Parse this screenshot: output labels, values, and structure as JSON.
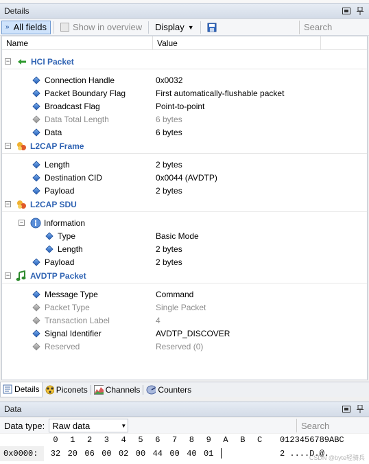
{
  "details_panel": {
    "title": "Details"
  },
  "toolbar": {
    "all_fields": "All fields",
    "show_in_overview": "Show in overview",
    "display": "Display",
    "search_placeholder": "Search"
  },
  "columns": {
    "name": "Name",
    "value": "Value"
  },
  "groups": [
    {
      "title": "HCI Packet",
      "icon": "green-arrow-left-icon",
      "fields": [
        {
          "name": "Connection Handle",
          "value": "0x0032",
          "greyed": false
        },
        {
          "name": "Packet Boundary Flag",
          "value": "First automatically-flushable packet",
          "greyed": false
        },
        {
          "name": "Broadcast Flag",
          "value": "Point-to-point",
          "greyed": false
        },
        {
          "name": "Data Total Length",
          "value": "6 bytes",
          "greyed": true
        },
        {
          "name": "Data",
          "value": "6 bytes",
          "greyed": false
        }
      ]
    },
    {
      "title": "L2CAP Frame",
      "icon": "l2cap-frame-icon",
      "fields": [
        {
          "name": "Length",
          "value": "2 bytes",
          "greyed": false
        },
        {
          "name": "Destination CID",
          "value": "0x0044 (AVDTP)",
          "greyed": false
        },
        {
          "name": "Payload",
          "value": "2 bytes",
          "greyed": false
        }
      ]
    },
    {
      "title": "L2CAP SDU",
      "icon": "l2cap-sdu-icon",
      "subgroup": {
        "title": "Information",
        "fields": [
          {
            "name": "Type",
            "value": "Basic Mode"
          },
          {
            "name": "Length",
            "value": "2 bytes"
          }
        ]
      },
      "fields": [
        {
          "name": "Payload",
          "value": "2 bytes",
          "greyed": false
        }
      ]
    },
    {
      "title": "AVDTP Packet",
      "icon": "music-note-icon",
      "fields": [
        {
          "name": "Message Type",
          "value": "Command",
          "greyed": false
        },
        {
          "name": "Packet Type",
          "value": "Single Packet",
          "greyed": true
        },
        {
          "name": "Transaction Label",
          "value": "4",
          "greyed": true
        },
        {
          "name": "Signal Identifier",
          "value": "AVDTP_DISCOVER",
          "greyed": false
        },
        {
          "name": "Reserved",
          "value": "Reserved (0)",
          "greyed": true
        }
      ]
    }
  ],
  "tabs": [
    {
      "label": "Details",
      "icon": "details-icon",
      "active": true
    },
    {
      "label": "Piconets",
      "icon": "piconet-icon",
      "active": false
    },
    {
      "label": "Channels",
      "icon": "channels-icon",
      "active": false
    },
    {
      "label": "Counters",
      "icon": "counters-icon",
      "active": false
    }
  ],
  "data_panel": {
    "title": "Data",
    "data_type_label": "Data type:",
    "data_type_value": "Raw data",
    "search_placeholder": "Search",
    "hex_header": [
      "0",
      "1",
      "2",
      "3",
      "4",
      "5",
      "6",
      "7",
      "8",
      "9",
      "A",
      "B",
      "C"
    ],
    "ascii_header": "0123456789ABC",
    "address": "0x0000:",
    "bytes": [
      "32",
      "20",
      "06",
      "00",
      "02",
      "00",
      "44",
      "00",
      "40",
      "01"
    ],
    "ascii": "2 ....D.@."
  },
  "watermark": "CSDN @byte轻骑兵"
}
